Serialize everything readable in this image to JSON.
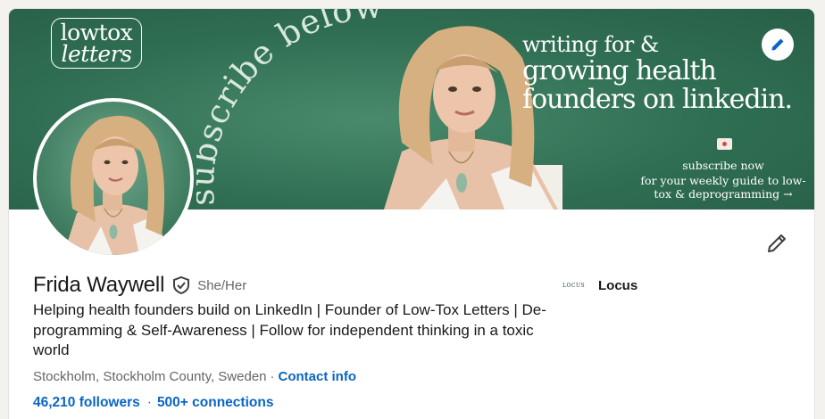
{
  "banner": {
    "logo_line1": "lowtox",
    "logo_line2": "letters",
    "arc_text": "subscribe below",
    "headline_line1": "writing for &",
    "headline_line2": "growing health",
    "headline_line3": "founders on linkedin.",
    "subscribe_line1": "subscribe now",
    "subscribe_line2": "for your weekly guide to low-tox & deprogramming →",
    "background_color": "#2f6e52"
  },
  "profile": {
    "name": "Frida Waywell",
    "pronouns": "She/Her",
    "headline": "Helping health founders build on LinkedIn | Founder of Low-Tox Letters | De-programming & Self-Awareness | Follow for independent thinking in a toxic world",
    "location": "Stockholm, Stockholm County, Sweden",
    "location_separator": "·",
    "contact_info": "Contact info",
    "followers": "46,210 followers",
    "stats_separator": "·",
    "connections": "500+ connections"
  },
  "company": {
    "logo_text": "LOCUS",
    "name": "Locus"
  },
  "icons": {
    "banner_edit": "pencil-icon",
    "profile_edit": "pencil-icon",
    "verified": "verified-shield-icon"
  },
  "colors": {
    "link": "#0a66c2",
    "banner_green": "#2f6e52",
    "text_primary": "#191919",
    "text_secondary": "#666666"
  }
}
